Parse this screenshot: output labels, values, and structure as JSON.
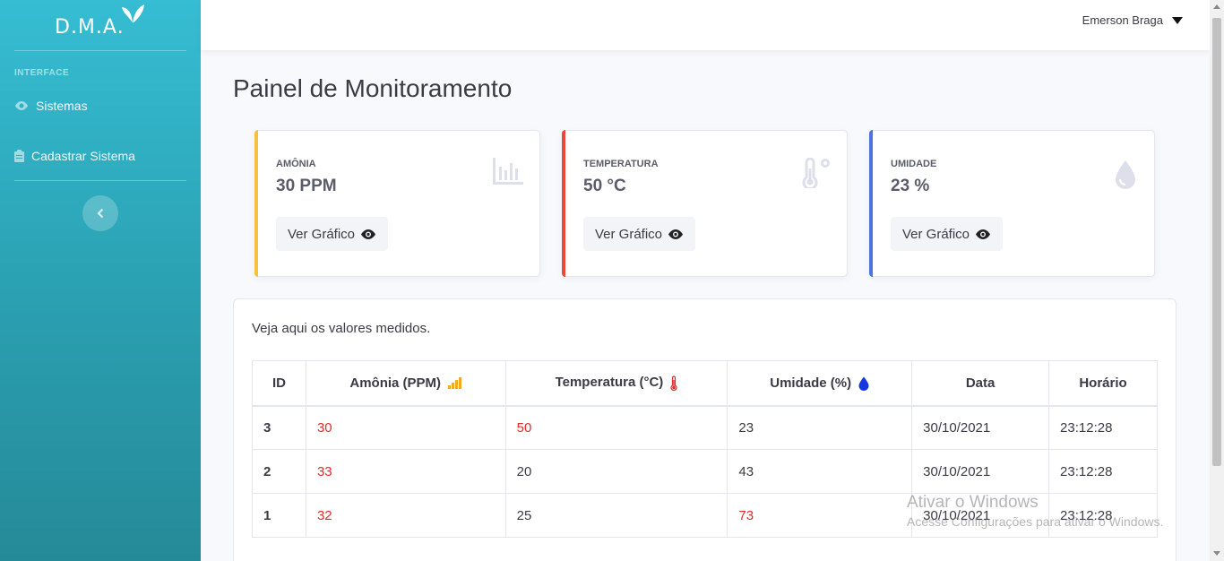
{
  "brand": {
    "name": "D.M.A."
  },
  "sidebar": {
    "heading": "INTERFACE",
    "items": [
      {
        "label": "Sistemas",
        "icon": "eye-icon"
      },
      {
        "label": "Cadastrar Sistema",
        "icon": "clipboard-icon"
      }
    ]
  },
  "topbar": {
    "user_name": "Emerson Braga"
  },
  "page": {
    "title": "Painel de Monitoramento"
  },
  "cards": [
    {
      "label": "AMÔNIA",
      "value": "30 PPM",
      "button": "Ver Gráfico",
      "accent": "#f6c23e",
      "icon": "bar-chart-icon"
    },
    {
      "label": "TEMPERATURA",
      "value": "50 °C",
      "button": "Ver Gráfico",
      "accent": "#e74a3b",
      "icon": "thermometer-icon"
    },
    {
      "label": "UMIDADE",
      "value": "23 %",
      "button": "Ver Gráfico",
      "accent": "#4e73df",
      "icon": "droplet-icon"
    }
  ],
  "table": {
    "intro": "Veja aqui os valores medidos.",
    "headers": [
      "ID",
      "Amônia (PPM)",
      "Temperatura (°C)",
      "Umidade (%)",
      "Data",
      "Horário"
    ],
    "rows": [
      {
        "id": "3",
        "amonia": "30",
        "temperatura": "50",
        "umidade": "23",
        "data": "30/10/2021",
        "horario": "23:12:28"
      },
      {
        "id": "2",
        "amonia": "33",
        "temperatura": "20",
        "umidade": "43",
        "data": "30/10/2021",
        "horario": "23:12:28"
      },
      {
        "id": "1",
        "amonia": "32",
        "temperatura": "25",
        "umidade": "73",
        "data": "30/10/2021",
        "horario": "23:12:28"
      }
    ]
  },
  "watermark": {
    "line1": "Ativar o Windows",
    "line2": "Acesse Configurações para ativar o Windows."
  },
  "colors": {
    "alert": "#e02d2d",
    "sidebar_top": "#36bdd3",
    "sidebar_bottom": "#258a98"
  }
}
